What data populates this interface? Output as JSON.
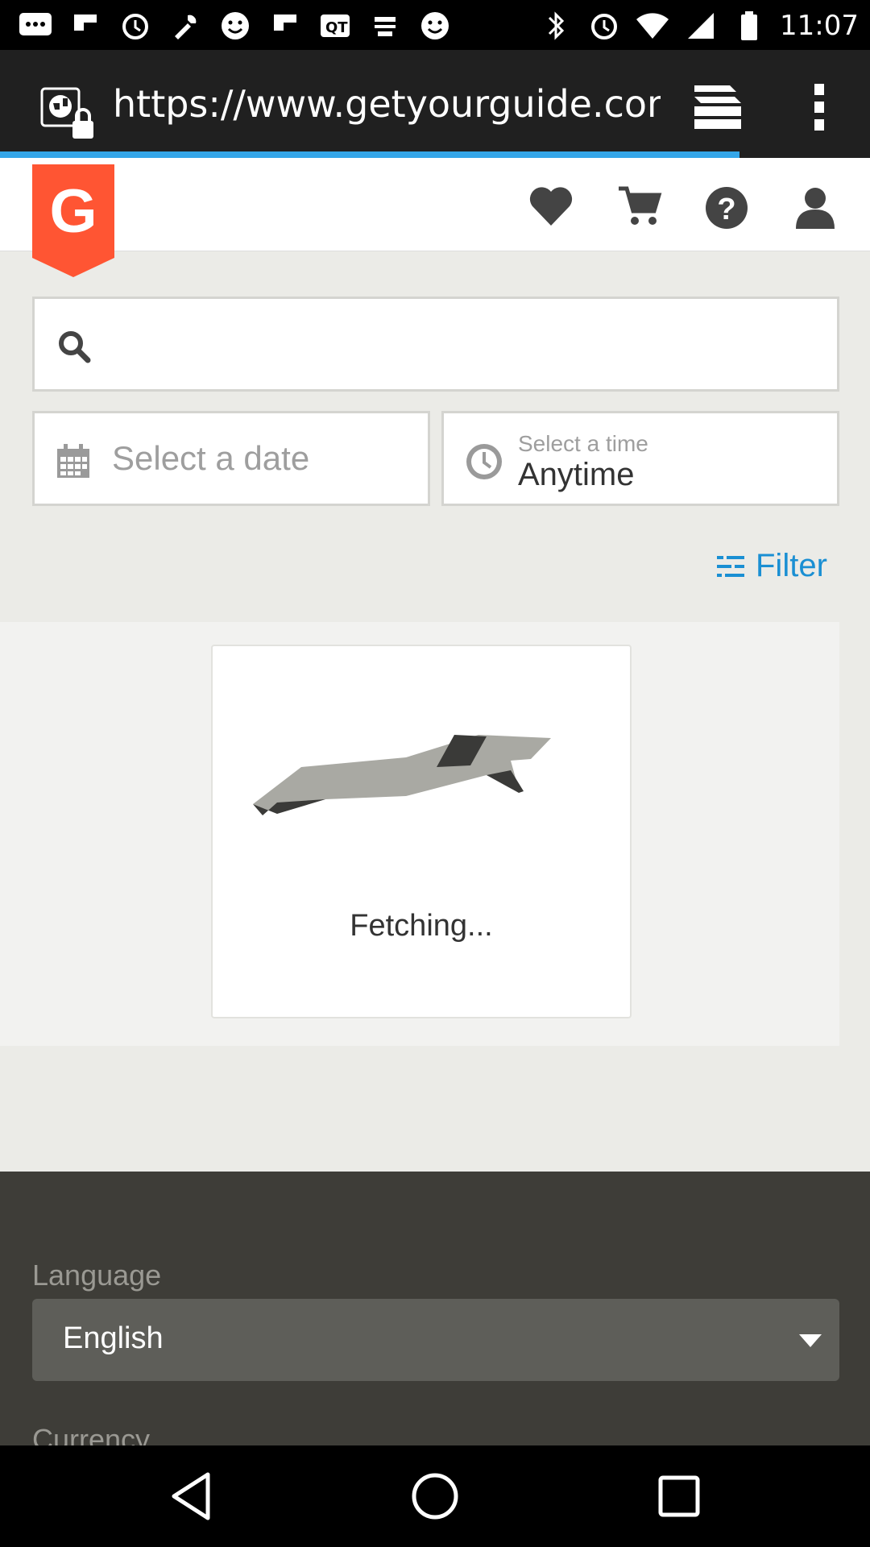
{
  "status_bar": {
    "time": "11:07",
    "icons": [
      "messages-icon",
      "flipboard-icon",
      "alarm-icon",
      "wrench-icon",
      "smiley-icon",
      "flipboard-icon",
      "qt-icon",
      "app-icon",
      "smiley-icon",
      "bluetooth-icon",
      "alarm-icon",
      "wifi-icon",
      "signal-icon",
      "battery-icon"
    ]
  },
  "browser": {
    "url": "https://www.getyourguide.com/",
    "progress_fraction": 0.85,
    "accent_color": "#35a6e8"
  },
  "header": {
    "logo_letter": "G",
    "logo_color": "#ff5533",
    "icons": [
      "heart-icon",
      "cart-icon",
      "help-icon",
      "user-icon"
    ]
  },
  "search": {
    "placeholder": "",
    "value": ""
  },
  "date_field": {
    "placeholder": "Select a date"
  },
  "time_field": {
    "label": "Select a time",
    "value": "Anytime"
  },
  "filter": {
    "label": "Filter",
    "color": "#1a8fd3"
  },
  "loading": {
    "text": "Fetching..."
  },
  "footer": {
    "language_label": "Language",
    "language_value": "English",
    "currency_label": "Currency"
  }
}
